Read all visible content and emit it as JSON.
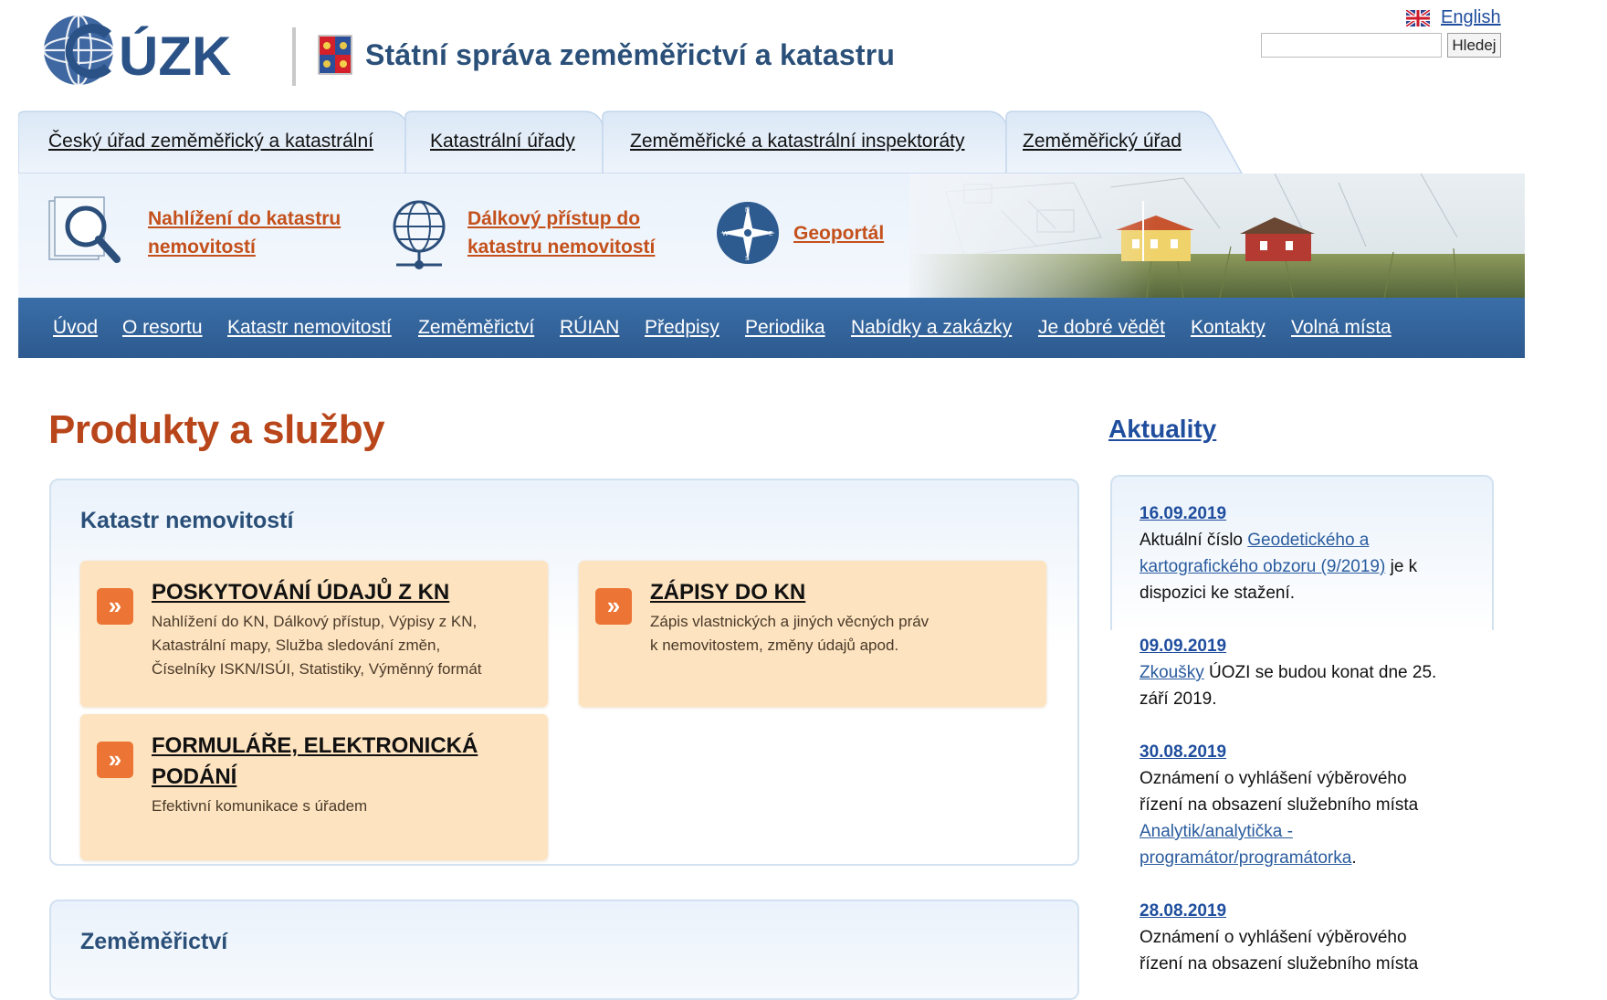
{
  "header": {
    "logo_text": "ÚZK",
    "site_title": "Státní správa zeměměřictví a katastru",
    "language_link": "English",
    "search_placeholder": "",
    "search_button": "Hledej"
  },
  "tabs": [
    {
      "label": "Český úřad zeměměřický a katastrální"
    },
    {
      "label": "Katastrální úřady"
    },
    {
      "label": "Zeměměřické a katastrální inspektoráty"
    },
    {
      "label": "Zeměměřický úřad"
    }
  ],
  "quick_links": [
    {
      "line1": "Nahlížení do katastru",
      "line2": "nemovitostí",
      "icon": "magnifier-icon"
    },
    {
      "line1": "Dálkový přístup do",
      "line2": "katastru nemovitostí",
      "icon": "globe-icon"
    },
    {
      "line1": "Geoportál",
      "line2": "",
      "icon": "compass-icon"
    }
  ],
  "main_nav": [
    {
      "label": "Úvod"
    },
    {
      "label": "O resortu"
    },
    {
      "label": "Katastr nemovitostí"
    },
    {
      "label": "Zeměměřictví"
    },
    {
      "label": "RÚIAN"
    },
    {
      "label": "Předpisy"
    },
    {
      "label": "Periodika"
    },
    {
      "label": "Nabídky a zakázky"
    },
    {
      "label": "Je dobré vědět"
    },
    {
      "label": "Kontakty"
    },
    {
      "label": "Volná místa"
    }
  ],
  "main": {
    "page_title": "Produkty a služby",
    "sections": [
      {
        "title": "Katastr nemovitostí",
        "cards": [
          {
            "title": "POSKYTOVÁNÍ ÚDAJŮ Z KN",
            "text": [
              "Nahlížení do KN, Dálkový přístup, Výpisy z KN,",
              "Katastrální mapy, Služba sledování změn,",
              "Číselníky ISKN/ISÚI, Statistiky, Výměnný formát"
            ]
          },
          {
            "title": "ZÁPISY DO KN",
            "text": [
              "Zápis vlastnických a jiných věcných práv",
              "k nemovitostem, změny údajů apod."
            ]
          },
          {
            "title_line1": "FORMULÁŘE, ELEKTRONICKÁ",
            "title_line2": "PODÁNÍ",
            "text": [
              "Efektivní komunikace s úřadem"
            ]
          }
        ]
      },
      {
        "title": "Zeměměřictví"
      }
    ],
    "card_icon_glyph": "»"
  },
  "sidebar": {
    "title": "Aktuality",
    "news": [
      {
        "date": "16.09.2019",
        "pre": "Aktuální číslo ",
        "link1": "Geodetického a",
        "link2": "kartografického obzoru (9/2019)",
        "post1": " je k",
        "post2": "dispozici ke stažení."
      },
      {
        "date": "09.09.2019",
        "link": "Zkoušky",
        "post1": " ÚOZI se budou konat dne 25.",
        "post2": "září 2019."
      },
      {
        "date": "30.08.2019",
        "line1": "Oznámení o vyhlášení výběrového",
        "line2": "řízení na obsazení služebního místa",
        "link1": "Analytik/analytička -",
        "link2": "programátor/programátorka",
        "post": "."
      },
      {
        "date": "28.08.2019",
        "line1": "Oznámení o vyhlášení výběrového",
        "line2": "řízení na obsazení služebního místa"
      }
    ]
  },
  "colors": {
    "brand_blue": "#2a4f78",
    "nav_blue": "#2d5a8f",
    "accent_orange": "#c4501b",
    "card_bg": "#fde3bf",
    "card_icon": "#ec7434",
    "link_blue": "#1f4e9e"
  }
}
